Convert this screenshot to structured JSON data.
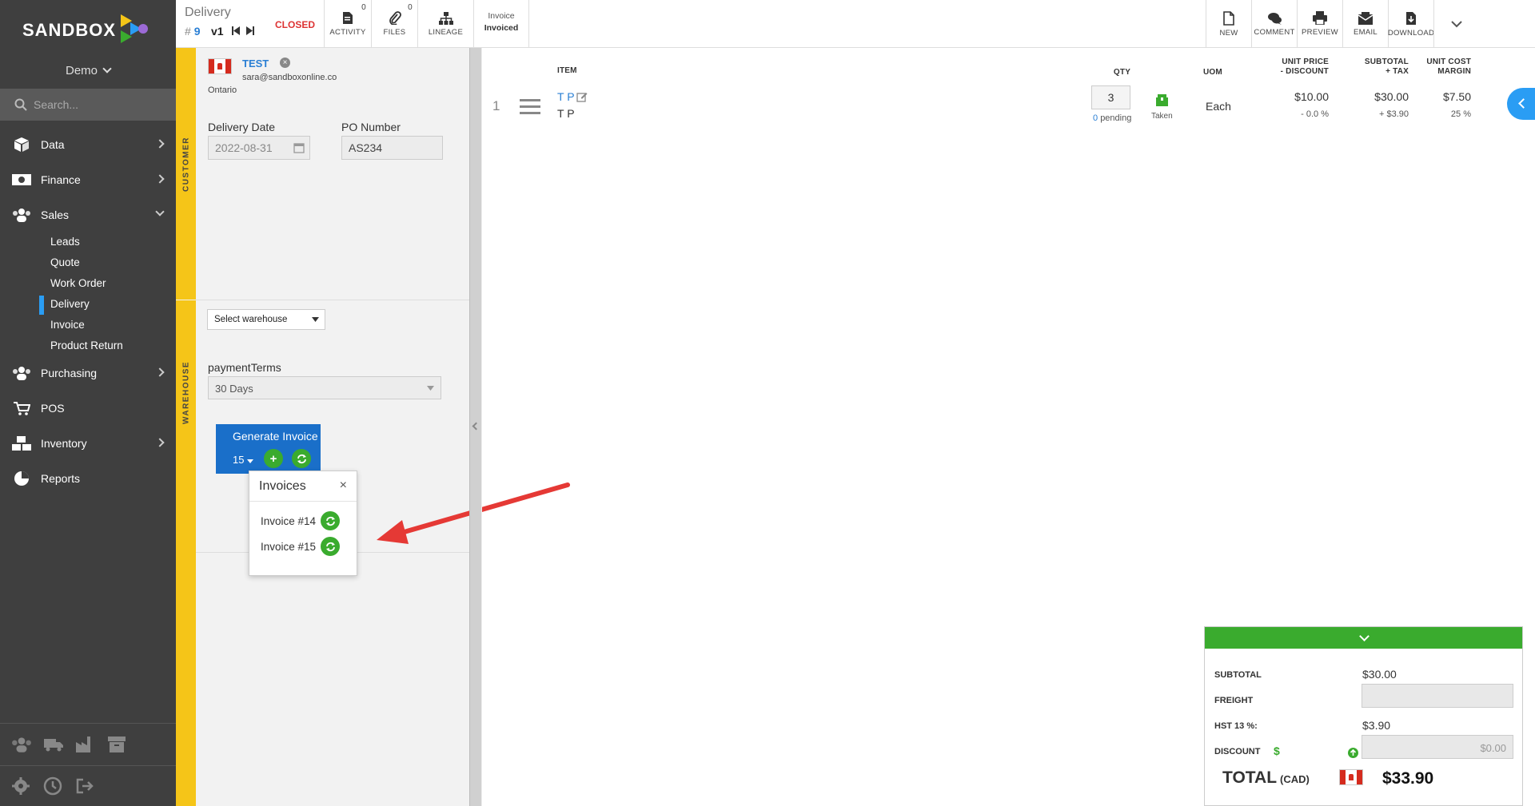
{
  "app": {
    "brand": "SANDBOX",
    "org": "Demo"
  },
  "search": {
    "placeholder": "Search..."
  },
  "sidebar": {
    "items": [
      {
        "label": "Data"
      },
      {
        "label": "Finance"
      },
      {
        "label": "Sales"
      },
      {
        "label": "Purchasing"
      },
      {
        "label": "POS"
      },
      {
        "label": "Inventory"
      },
      {
        "label": "Reports"
      }
    ],
    "sales_sub": [
      "Leads",
      "Quote",
      "Work Order",
      "Delivery",
      "Invoice",
      "Product Return"
    ],
    "active_sub": "Delivery"
  },
  "toolbar": {
    "title": "Delivery",
    "hash": "#",
    "number": "9",
    "version": "v1",
    "status": "CLOSED",
    "activity_label": "ACTIVITY",
    "activity_count": "0",
    "files_label": "FILES",
    "files_count": "0",
    "lineage_label": "LINEAGE",
    "invoice_label": "Invoice",
    "invoice_value": "Invoiced",
    "new_label": "NEW",
    "comment_label": "COMMENT",
    "preview_label": "PREVIEW",
    "email_label": "EMAIL",
    "download_label": "DOWNLOAD"
  },
  "customer": {
    "section_label": "CUSTOMER",
    "name": "TEST",
    "email": "sara@sandboxonline.co",
    "region": "Ontario",
    "delivery_date_label": "Delivery Date",
    "delivery_date": "2022-08-31",
    "po_label": "PO Number",
    "po_number": "AS234"
  },
  "warehouse": {
    "section_label": "WAREHOUSE",
    "select_label": "Select warehouse",
    "payment_terms_label": "paymentTerms",
    "payment_terms": "30 Days"
  },
  "generate_invoice": {
    "label": "Generate Invoice",
    "count": "15"
  },
  "invoices_popover": {
    "title": "Invoices",
    "close": "×",
    "items": [
      "Invoice #14",
      "Invoice #15"
    ]
  },
  "items_table": {
    "headers": {
      "item": "ITEM",
      "qty": "QTY",
      "uom": "UOM",
      "unit_price_1": "UNIT PRICE",
      "unit_price_2": "- DISCOUNT",
      "subtotal_1": "SUBTOTAL",
      "subtotal_2": "+ TAX",
      "unit_cost_1": "UNIT COST",
      "unit_cost_2": "MARGIN"
    },
    "rows": [
      {
        "index": "1",
        "item": "T P",
        "description": "T P",
        "qty": "3",
        "pending_count": "0",
        "pending_label": "pending",
        "status": "Taken",
        "uom": "Each",
        "unit_price": "$10.00",
        "discount": "- 0.0 %",
        "subtotal": "$30.00",
        "tax": "+ $3.90",
        "unit_cost": "$7.50",
        "margin": "25 %"
      }
    ]
  },
  "totals": {
    "subtotal_label": "SUBTOTAL",
    "subtotal": "$30.00",
    "freight_label": "FREIGHT",
    "hst_label": "HST 13 %:",
    "hst": "$3.90",
    "discount_label": "DISCOUNT",
    "discount_symbol": "$",
    "discount_value": "$0.00",
    "total_label": "TOTAL",
    "currency": "(CAD)",
    "total": "$33.90"
  },
  "colors": {
    "sidebar_bg": "#3f3f3f",
    "accent_blue": "#2a9df4",
    "section_yellow": "#f5c518",
    "success_green": "#3aab2e",
    "status_red": "#d33333",
    "button_blue": "#1a6fc9"
  }
}
